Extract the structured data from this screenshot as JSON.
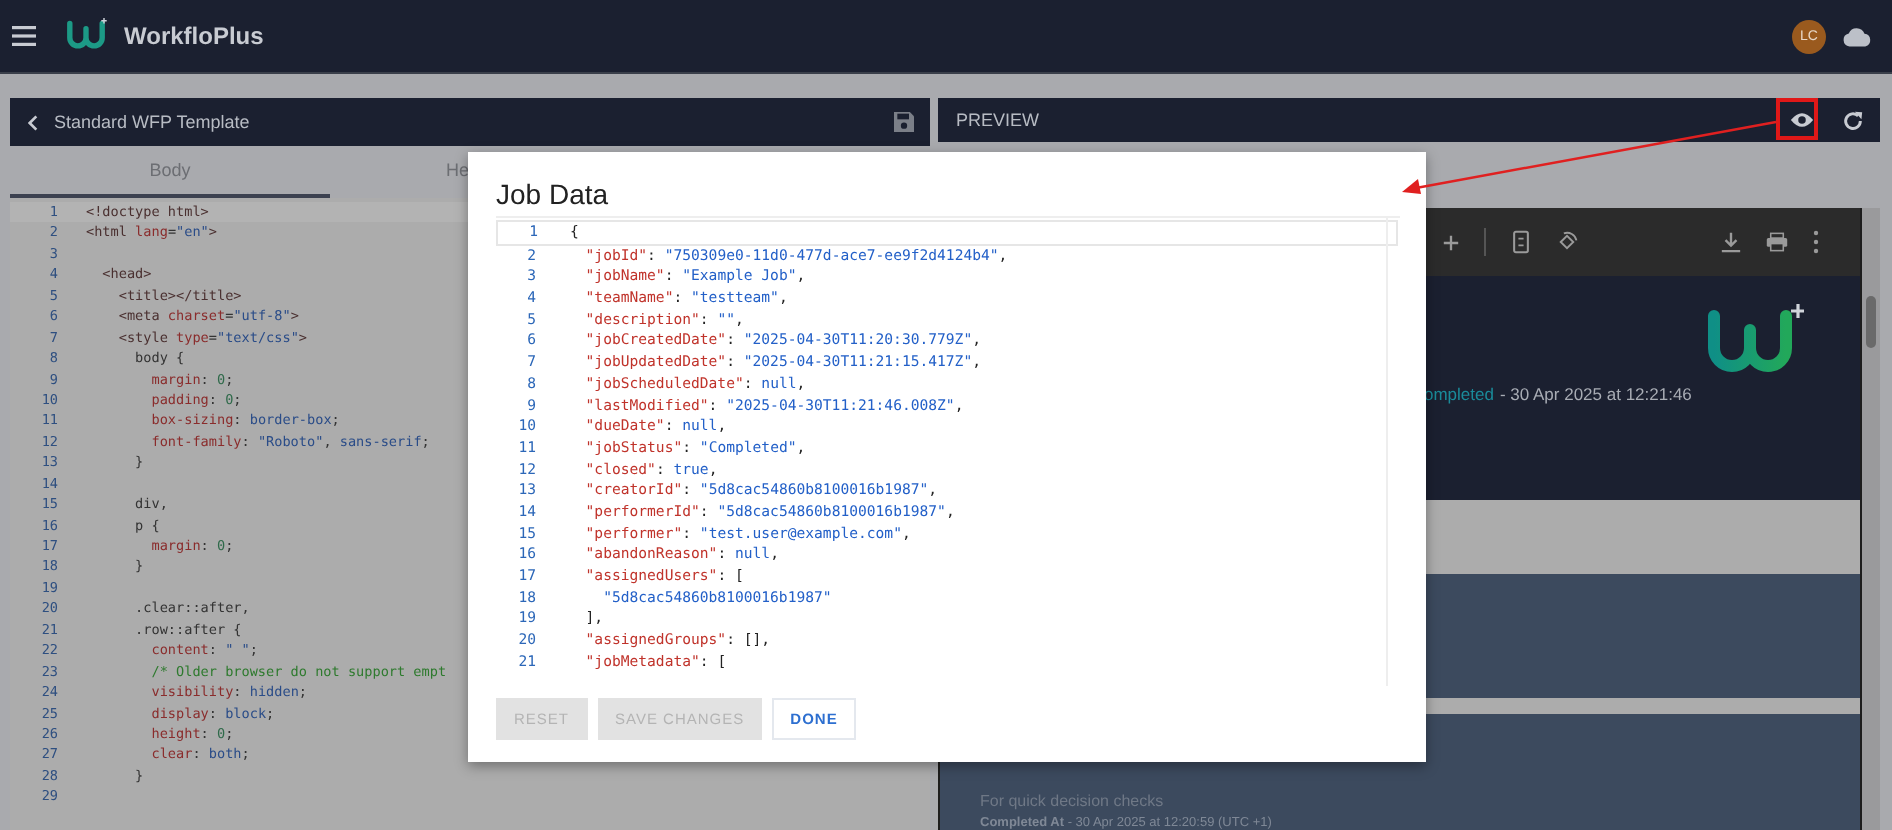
{
  "app": {
    "title": "WorkfloPlus",
    "user_initials": "LC"
  },
  "template_panel": {
    "title": "Standard WFP Template",
    "tabs": [
      {
        "label": "Body",
        "selected": true
      },
      {
        "label": "He",
        "selected": false
      }
    ],
    "code_lines": [
      {
        "number": "1",
        "tokens": [
          {
            "kind": "tag",
            "text": "<!doctype html>"
          }
        ]
      },
      {
        "number": "2",
        "tokens": [
          {
            "kind": "tag",
            "text": "<html"
          },
          {
            "kind": "attr",
            "text": " lang"
          },
          {
            "kind": "punct",
            "text": "="
          },
          {
            "kind": "str",
            "text": "\"en\""
          },
          {
            "kind": "tag",
            "text": ">"
          }
        ]
      },
      {
        "number": "3"
      },
      {
        "number": "4",
        "tokens": [
          {
            "kind": "tag",
            "text": "  <head>"
          }
        ]
      },
      {
        "number": "5",
        "tokens": [
          {
            "kind": "tag",
            "text": "    <title></title>"
          }
        ]
      },
      {
        "number": "6",
        "tokens": [
          {
            "kind": "tag",
            "text": "    <meta"
          },
          {
            "kind": "attr",
            "text": " charset"
          },
          {
            "kind": "punct",
            "text": "="
          },
          {
            "kind": "str",
            "text": "\"utf-8\""
          },
          {
            "kind": "tag",
            "text": ">"
          }
        ]
      },
      {
        "number": "7",
        "tokens": [
          {
            "kind": "tag",
            "text": "    <style"
          },
          {
            "kind": "attr",
            "text": " type"
          },
          {
            "kind": "punct",
            "text": "="
          },
          {
            "kind": "str",
            "text": "\"text/css\""
          },
          {
            "kind": "tag",
            "text": ">"
          }
        ]
      },
      {
        "number": "8",
        "tokens": [
          {
            "kind": "plain",
            "text": "      body {"
          }
        ]
      },
      {
        "number": "9",
        "tokens": [
          {
            "kind": "prop",
            "text": "        margin"
          },
          {
            "kind": "punct",
            "text": ": "
          },
          {
            "kind": "num",
            "text": "0"
          },
          {
            "kind": "punct",
            "text": ";"
          }
        ]
      },
      {
        "number": "10",
        "tokens": [
          {
            "kind": "prop",
            "text": "        padding"
          },
          {
            "kind": "punct",
            "text": ": "
          },
          {
            "kind": "num",
            "text": "0"
          },
          {
            "kind": "punct",
            "text": ";"
          }
        ]
      },
      {
        "number": "11",
        "tokens": [
          {
            "kind": "prop",
            "text": "        box-sizing"
          },
          {
            "kind": "punct",
            "text": ": "
          },
          {
            "kind": "val",
            "text": "border-box"
          },
          {
            "kind": "punct",
            "text": ";"
          }
        ]
      },
      {
        "number": "12",
        "tokens": [
          {
            "kind": "prop",
            "text": "        font-family"
          },
          {
            "kind": "punct",
            "text": ": "
          },
          {
            "kind": "str",
            "text": "\"Roboto\""
          },
          {
            "kind": "punct",
            "text": ", "
          },
          {
            "kind": "val",
            "text": "sans-serif"
          },
          {
            "kind": "punct",
            "text": ";"
          }
        ]
      },
      {
        "number": "13",
        "tokens": [
          {
            "kind": "plain",
            "text": "      }"
          }
        ]
      },
      {
        "number": "14"
      },
      {
        "number": "15",
        "tokens": [
          {
            "kind": "plain",
            "text": "      div,"
          }
        ]
      },
      {
        "number": "16",
        "tokens": [
          {
            "kind": "plain",
            "text": "      p {"
          }
        ]
      },
      {
        "number": "17",
        "tokens": [
          {
            "kind": "prop",
            "text": "        margin"
          },
          {
            "kind": "punct",
            "text": ": "
          },
          {
            "kind": "num",
            "text": "0"
          },
          {
            "kind": "punct",
            "text": ";"
          }
        ]
      },
      {
        "number": "18",
        "tokens": [
          {
            "kind": "plain",
            "text": "      }"
          }
        ]
      },
      {
        "number": "19"
      },
      {
        "number": "20",
        "tokens": [
          {
            "kind": "plain",
            "text": "      .clear::after,"
          }
        ]
      },
      {
        "number": "21",
        "tokens": [
          {
            "kind": "plain",
            "text": "      .row::after {"
          }
        ]
      },
      {
        "number": "22",
        "tokens": [
          {
            "kind": "prop",
            "text": "        content"
          },
          {
            "kind": "punct",
            "text": ": "
          },
          {
            "kind": "str",
            "text": "\" \""
          },
          {
            "kind": "punct",
            "text": ";"
          }
        ]
      },
      {
        "number": "23",
        "tokens": [
          {
            "kind": "comment",
            "text": "        /* Older browser do not support empt"
          }
        ]
      },
      {
        "number": "24",
        "tokens": [
          {
            "kind": "prop",
            "text": "        visibility"
          },
          {
            "kind": "punct",
            "text": ": "
          },
          {
            "kind": "val",
            "text": "hidden"
          },
          {
            "kind": "punct",
            "text": ";"
          }
        ]
      },
      {
        "number": "25",
        "tokens": [
          {
            "kind": "prop",
            "text": "        display"
          },
          {
            "kind": "punct",
            "text": ": "
          },
          {
            "kind": "val",
            "text": "block"
          },
          {
            "kind": "punct",
            "text": ";"
          }
        ]
      },
      {
        "number": "26",
        "tokens": [
          {
            "kind": "prop",
            "text": "        height"
          },
          {
            "kind": "punct",
            "text": ": "
          },
          {
            "kind": "num",
            "text": "0"
          },
          {
            "kind": "punct",
            "text": ";"
          }
        ]
      },
      {
        "number": "27",
        "tokens": [
          {
            "kind": "prop",
            "text": "        clear"
          },
          {
            "kind": "punct",
            "text": ": "
          },
          {
            "kind": "val",
            "text": "both"
          },
          {
            "kind": "punct",
            "text": ";"
          }
        ]
      },
      {
        "number": "28",
        "tokens": [
          {
            "kind": "plain",
            "text": "      }"
          }
        ]
      },
      {
        "number": "29"
      }
    ]
  },
  "preview_panel": {
    "title": "PREVIEW",
    "document": {
      "status": "ompleted",
      "status_time": "- 30 Apr 2025 at 12:21:46",
      "card_subtitle": "For quick decision checks",
      "card_completed": "**Completed At** - 30 Apr 2025 at 12:20:59 (UTC +1)"
    }
  },
  "dialog": {
    "title": "Job Data",
    "lines": [
      {
        "number": "1",
        "tokens": [
          {
            "kind": "punct",
            "text": "{"
          }
        ]
      },
      {
        "number": "2",
        "tokens": [
          {
            "kind": "key",
            "text": "  \"jobId\""
          },
          {
            "kind": "punct",
            "text": ": "
          },
          {
            "kind": "str",
            "text": "\"750309e0-11d0-477d-ace7-ee9f2d4124b4\""
          },
          {
            "kind": "punct",
            "text": ","
          }
        ]
      },
      {
        "number": "3",
        "tokens": [
          {
            "kind": "key",
            "text": "  \"jobName\""
          },
          {
            "kind": "punct",
            "text": ": "
          },
          {
            "kind": "str",
            "text": "\"Example Job\""
          },
          {
            "kind": "punct",
            "text": ","
          }
        ]
      },
      {
        "number": "4",
        "tokens": [
          {
            "kind": "key",
            "text": "  \"teamName\""
          },
          {
            "kind": "punct",
            "text": ": "
          },
          {
            "kind": "str",
            "text": "\"testteam\""
          },
          {
            "kind": "punct",
            "text": ","
          }
        ]
      },
      {
        "number": "5",
        "tokens": [
          {
            "kind": "key",
            "text": "  \"description\""
          },
          {
            "kind": "punct",
            "text": ": "
          },
          {
            "kind": "str",
            "text": "\"\""
          },
          {
            "kind": "punct",
            "text": ","
          }
        ]
      },
      {
        "number": "6",
        "tokens": [
          {
            "kind": "key",
            "text": "  \"jobCreatedDate\""
          },
          {
            "kind": "punct",
            "text": ": "
          },
          {
            "kind": "str",
            "text": "\"2025-04-30T11:20:30.779Z\""
          },
          {
            "kind": "punct",
            "text": ","
          }
        ]
      },
      {
        "number": "7",
        "tokens": [
          {
            "kind": "key",
            "text": "  \"jobUpdatedDate\""
          },
          {
            "kind": "punct",
            "text": ": "
          },
          {
            "kind": "str",
            "text": "\"2025-04-30T11:21:15.417Z\""
          },
          {
            "kind": "punct",
            "text": ","
          }
        ]
      },
      {
        "number": "8",
        "tokens": [
          {
            "kind": "key",
            "text": "  \"jobScheduledDate\""
          },
          {
            "kind": "punct",
            "text": ": "
          },
          {
            "kind": "lit",
            "text": "null"
          },
          {
            "kind": "punct",
            "text": ","
          }
        ]
      },
      {
        "number": "9",
        "tokens": [
          {
            "kind": "key",
            "text": "  \"lastModified\""
          },
          {
            "kind": "punct",
            "text": ": "
          },
          {
            "kind": "str",
            "text": "\"2025-04-30T11:21:46.008Z\""
          },
          {
            "kind": "punct",
            "text": ","
          }
        ]
      },
      {
        "number": "10",
        "tokens": [
          {
            "kind": "key",
            "text": "  \"dueDate\""
          },
          {
            "kind": "punct",
            "text": ": "
          },
          {
            "kind": "lit",
            "text": "null"
          },
          {
            "kind": "punct",
            "text": ","
          }
        ]
      },
      {
        "number": "11",
        "tokens": [
          {
            "kind": "key",
            "text": "  \"jobStatus\""
          },
          {
            "kind": "punct",
            "text": ": "
          },
          {
            "kind": "str",
            "text": "\"Completed\""
          },
          {
            "kind": "punct",
            "text": ","
          }
        ]
      },
      {
        "number": "12",
        "tokens": [
          {
            "kind": "key",
            "text": "  \"closed\""
          },
          {
            "kind": "punct",
            "text": ": "
          },
          {
            "kind": "lit",
            "text": "true"
          },
          {
            "kind": "punct",
            "text": ","
          }
        ]
      },
      {
        "number": "13",
        "tokens": [
          {
            "kind": "key",
            "text": "  \"creatorId\""
          },
          {
            "kind": "punct",
            "text": ": "
          },
          {
            "kind": "str",
            "text": "\"5d8cac54860b8100016b1987\""
          },
          {
            "kind": "punct",
            "text": ","
          }
        ]
      },
      {
        "number": "14",
        "tokens": [
          {
            "kind": "key",
            "text": "  \"performerId\""
          },
          {
            "kind": "punct",
            "text": ": "
          },
          {
            "kind": "str",
            "text": "\"5d8cac54860b8100016b1987\""
          },
          {
            "kind": "punct",
            "text": ","
          }
        ]
      },
      {
        "number": "15",
        "tokens": [
          {
            "kind": "key",
            "text": "  \"performer\""
          },
          {
            "kind": "punct",
            "text": ": "
          },
          {
            "kind": "str",
            "text": "\"test.user@example.com\""
          },
          {
            "kind": "punct",
            "text": ","
          }
        ]
      },
      {
        "number": "16",
        "tokens": [
          {
            "kind": "key",
            "text": "  \"abandonReason\""
          },
          {
            "kind": "punct",
            "text": ": "
          },
          {
            "kind": "lit",
            "text": "null"
          },
          {
            "kind": "punct",
            "text": ","
          }
        ]
      },
      {
        "number": "17",
        "tokens": [
          {
            "kind": "key",
            "text": "  \"assignedUsers\""
          },
          {
            "kind": "punct",
            "text": ": ["
          }
        ]
      },
      {
        "number": "18",
        "tokens": [
          {
            "kind": "str",
            "text": "    \"5d8cac54860b8100016b1987\""
          }
        ]
      },
      {
        "number": "19",
        "tokens": [
          {
            "kind": "punct",
            "text": "  ],"
          }
        ]
      },
      {
        "number": "20",
        "tokens": [
          {
            "kind": "key",
            "text": "  \"assignedGroups\""
          },
          {
            "kind": "punct",
            "text": ": [],"
          }
        ]
      },
      {
        "number": "21",
        "tokens": [
          {
            "kind": "key",
            "text": "  \"jobMetadata\""
          },
          {
            "kind": "punct",
            "text": ": ["
          }
        ]
      }
    ],
    "buttons": [
      {
        "label": "RESET",
        "disabled": true
      },
      {
        "label": "SAVE CHANGES",
        "disabled": true
      },
      {
        "label": "DONE",
        "disabled": false
      }
    ]
  }
}
